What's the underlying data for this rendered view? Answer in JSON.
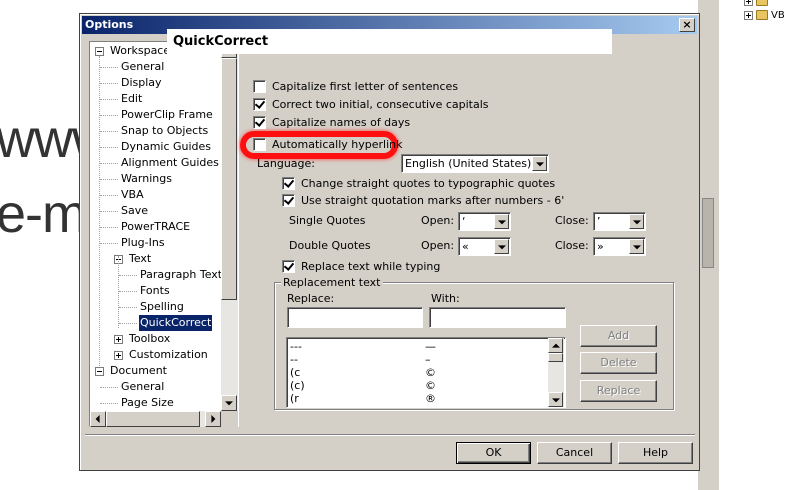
{
  "background": {
    "text_line1": "www",
    "text_line2": "e-m",
    "tree_items": [
      "VB"
    ]
  },
  "dialog": {
    "title": "Options",
    "close_label": "×"
  },
  "tree": {
    "items": [
      {
        "label": "Workspace",
        "expander": "minus"
      },
      {
        "label": "General"
      },
      {
        "label": "Display"
      },
      {
        "label": "Edit"
      },
      {
        "label": "PowerClip Frame"
      },
      {
        "label": "Snap to Objects"
      },
      {
        "label": "Dynamic Guides"
      },
      {
        "label": "Alignment Guides"
      },
      {
        "label": "Warnings"
      },
      {
        "label": "VBA"
      },
      {
        "label": "Save"
      },
      {
        "label": "PowerTRACE"
      },
      {
        "label": "Plug-Ins"
      },
      {
        "label": "Text",
        "expander": "minus"
      },
      {
        "label": "Paragraph Text"
      },
      {
        "label": "Fonts"
      },
      {
        "label": "Spelling"
      },
      {
        "label": "QuickCorrect",
        "selected": true
      },
      {
        "label": "Toolbox",
        "expander": "plus"
      },
      {
        "label": "Customization",
        "expander": "plus"
      },
      {
        "label": "Document",
        "expander": "minus"
      },
      {
        "label": "General"
      },
      {
        "label": "Page Size"
      }
    ]
  },
  "quickcorrect": {
    "header": "QuickCorrect",
    "options": [
      {
        "label": "Capitalize first letter of sentences",
        "checked": false
      },
      {
        "label": "Correct two initial, consecutive capitals",
        "checked": true
      },
      {
        "label": "Capitalize names of days",
        "checked": true
      },
      {
        "label": "Automatically hyperlink",
        "checked": false
      }
    ],
    "language_label": "Language:",
    "language_value": "English (United States)",
    "change_quotes_label": "Change straight quotes to typographic quotes",
    "change_quotes_checked": true,
    "straight_marks_label": "Use straight quotation marks after numbers - 6'",
    "straight_marks_checked": true,
    "single_quotes_label": "Single Quotes",
    "double_quotes_label": "Double Quotes",
    "open_label": "Open:",
    "close_label": "Close:",
    "single_open_value": "‘",
    "single_close_value": "’",
    "double_open_value": "«",
    "double_close_value": "»",
    "replace_typing_label": "Replace text while typing",
    "replace_typing_checked": true,
    "replacement_group_title": "Replacement text",
    "replace_label": "Replace:",
    "with_label": "With:",
    "replace_value": "",
    "with_value": "",
    "list": [
      {
        "replace": "---",
        "with": "—"
      },
      {
        "replace": "--",
        "with": "–"
      },
      {
        "replace": "(c",
        "with": "©"
      },
      {
        "replace": "(c)",
        "with": "©"
      },
      {
        "replace": "(r",
        "with": "®"
      }
    ],
    "add_button": "Add",
    "delete_button": "Delete",
    "replace_button": "Replace"
  },
  "footer": {
    "ok_button": "OK",
    "cancel_button": "Cancel",
    "help_button": "Help"
  },
  "colors": {
    "titlebar_start": "#0a246a",
    "titlebar_end": "#a6caf0",
    "dialog_face": "#d4d0c8",
    "highlight_ring": "#ff1010",
    "selection": "#0a246a"
  }
}
